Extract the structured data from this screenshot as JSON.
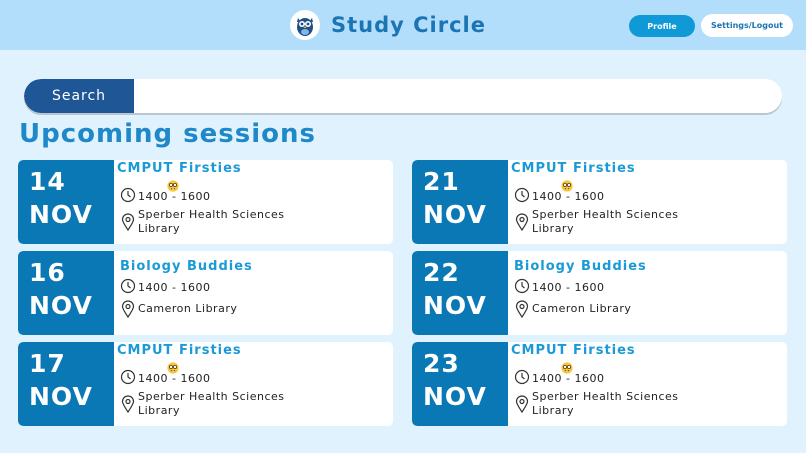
{
  "app": {
    "title": "Study Circle"
  },
  "header": {
    "profile_label": "Profile",
    "settings_label": "Settings/Logout"
  },
  "search": {
    "label": "Search",
    "placeholder": ""
  },
  "section": {
    "title": "Upcoming sessions"
  },
  "colors": {
    "header": "#b3defb",
    "background": "#dff2fd",
    "date_block": "#0b78b6",
    "accent": "#1a9ad6",
    "search_label": "#1f5796"
  },
  "sessions": [
    {
      "day": "14",
      "month": "NOV",
      "group": "CMPUT Firsties",
      "emoji": "nerd-face-icon",
      "time": "1400 - 1600",
      "location_line1": "Sperber Health Sciences",
      "location_line2": "Library"
    },
    {
      "day": "21",
      "month": "NOV",
      "group": "CMPUT Firsties",
      "emoji": "nerd-face-icon",
      "time": "1400 - 1600",
      "location_line1": "Sperber Health Sciences",
      "location_line2": "Library"
    },
    {
      "day": "16",
      "month": "NOV",
      "group": "Biology Buddies",
      "time": "1400 - 1600",
      "location_line1": "Cameron Library",
      "location_line2": ""
    },
    {
      "day": "22",
      "month": "NOV",
      "group": "Biology Buddies",
      "time": "1400 - 1600",
      "location_line1": "Cameron Library",
      "location_line2": ""
    },
    {
      "day": "17",
      "month": "NOV",
      "group": "CMPUT Firsties",
      "emoji": "nerd-face-icon",
      "time": "1400 - 1600",
      "location_line1": "Sperber Health Sciences",
      "location_line2": "Library"
    },
    {
      "day": "23",
      "month": "NOV",
      "group": "CMPUT Firsties",
      "emoji": "nerd-face-icon",
      "time": "1400 - 1600",
      "location_line1": "Sperber Health Sciences",
      "location_line2": "Library"
    }
  ]
}
